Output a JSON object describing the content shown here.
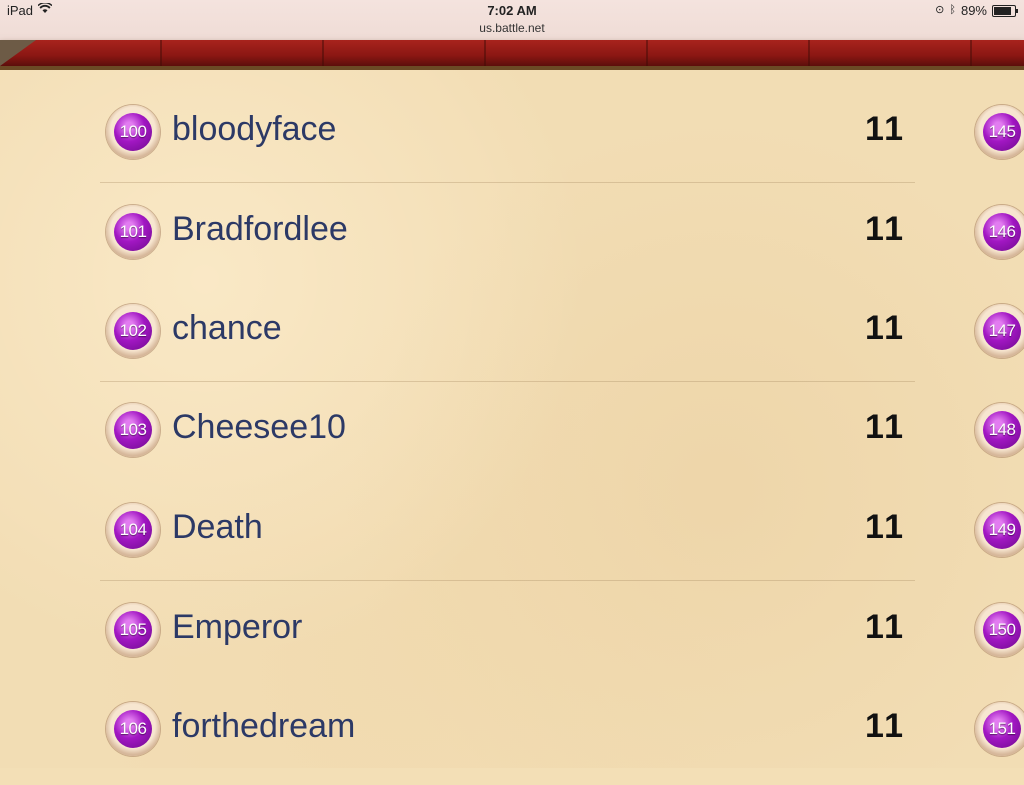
{
  "status_bar": {
    "device": "iPad",
    "time": "7:02 AM",
    "url": "us.battle.net",
    "battery": "89%"
  },
  "rows": [
    {
      "rank": "100",
      "name": "bloodyface",
      "count": "11"
    },
    {
      "rank": "101",
      "name": "Bradfordlee",
      "count": "11"
    },
    {
      "rank": "102",
      "name": "chance",
      "count": "11"
    },
    {
      "rank": "103",
      "name": "Cheesee10",
      "count": "11"
    },
    {
      "rank": "104",
      "name": "Death",
      "count": "11"
    },
    {
      "rank": "105",
      "name": "Emperor",
      "count": "11"
    },
    {
      "rank": "106",
      "name": "forthedream",
      "count": "11"
    }
  ],
  "right_column_ranks": [
    "145",
    "146",
    "147",
    "148",
    "149",
    "150",
    "151"
  ],
  "colors": {
    "banner": "#8b1713",
    "parchment": "#f2ddb4",
    "name_text": "#2c3966",
    "badge_purple": "#a217c3"
  }
}
